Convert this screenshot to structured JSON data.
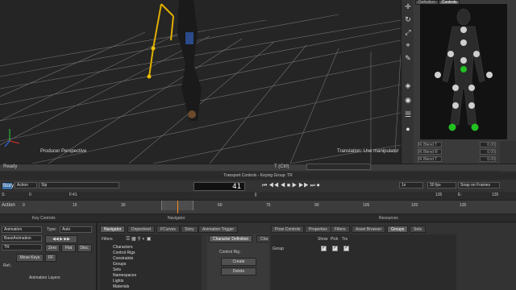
{
  "viewport": {
    "camera_label": "Producer Perspective",
    "status_label": "Translation: Use manipulator"
  },
  "tools": [
    "move-tool",
    "rotate-tool",
    "scale-tool",
    "select-tool",
    "edit-tool",
    "fk-tool",
    "ik-tool"
  ],
  "character_panel": {
    "tabs": [
      "Definition",
      "Controls"
    ],
    "blend_rows": [
      {
        "label": "IK Blend T",
        "value": "0.00"
      },
      {
        "label": "IK Blend R",
        "value": "0.00"
      },
      {
        "label": "IK Blend T",
        "value": "0.00"
      }
    ]
  },
  "status": {
    "ready": "Ready",
    "t_label": "T (Ctrl)"
  },
  "transport": {
    "title": "Transport Controls  -  Keying Group: TR",
    "story": "Story",
    "action": "Action",
    "take": "Slp",
    "frame": "41",
    "step": "41",
    "fps": "1x",
    "fps_rate": "30 fps",
    "snap": "Snap on Frames",
    "start_label": "S:",
    "start": "0",
    "end_label": "E:",
    "end": "135",
    "end2": "135"
  },
  "ruler": {
    "label": "Action",
    "ticks": [
      "0",
      "15",
      "30",
      "45",
      "60",
      "75",
      "90",
      "105",
      "120",
      "135"
    ]
  },
  "panels": {
    "key_controls": "Key Controls",
    "navigator": "Navigator",
    "resources": "Resources",
    "anim_layers": "Animation Layers"
  },
  "key_controls": {
    "mode": "Animation",
    "type_label": "Type:",
    "type_value": "Auto",
    "layer": "BaseAnimation",
    "tr": "TR",
    "zero": "Zero",
    "flat": "Flat",
    "disc": "Disc.",
    "move_keys": "Move Keys",
    "ff": "FF",
    "ref_label": "Ref.:"
  },
  "navigator": {
    "tabs": [
      "Navigator",
      "Dopesheet",
      "FCurves",
      "Story",
      "Animation Trigger"
    ],
    "filters": "Filters",
    "tree": [
      "Characters",
      "Control Rigs",
      "Constraints",
      "Groups",
      "Sets",
      "Namespaces",
      "Lights",
      "Materials"
    ],
    "char_def_tabs": [
      "Character Definition",
      "Cha"
    ],
    "control_rig_label": "Control Rig :",
    "create": "Create",
    "delete": "Delete"
  },
  "resources": {
    "tabs": [
      "Pose Controls",
      "Properties",
      "Filters",
      "Asset Browser",
      "Groups",
      "Sets"
    ],
    "columns": [
      "Show",
      "Pick",
      "Trs"
    ],
    "rows": [
      {
        "name": "Group",
        "show": true,
        "pick": true,
        "trs": true
      }
    ]
  }
}
